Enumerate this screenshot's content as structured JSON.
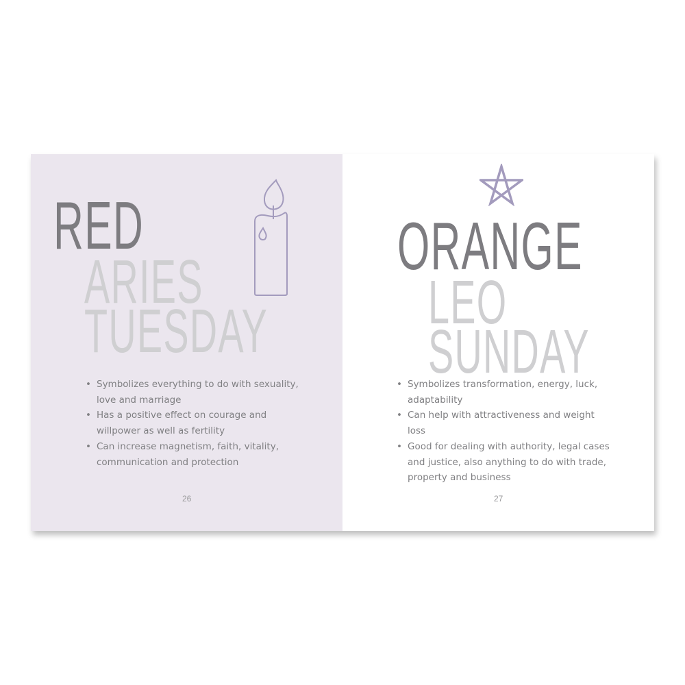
{
  "left_page": {
    "title": "RED",
    "zodiac": "ARIES",
    "day": "TUESDAY",
    "icon": "candle-icon",
    "bullets": [
      "Symbolizes everything to do with sexuality, love and marriage",
      "Has a positive effect on courage and willpower as well as fertility",
      "Can increase magnetism, faith, vitality, communication and protection"
    ],
    "page_number": "26"
  },
  "right_page": {
    "title": "ORANGE",
    "zodiac": "LEO",
    "day": "SUNDAY",
    "icon": "pentagram-icon",
    "bullets": [
      "Symbolizes transformation, energy, luck, adaptability",
      "Can help with attractiveness and weight loss",
      "Good for dealing with authority, legal cases and justice, also anything to do with trade, property and business"
    ],
    "page_number": "27"
  },
  "colors": {
    "left_background": "#ebe6ee",
    "accent": "#a39bbd",
    "title": "#7d7c80",
    "subtitle": "#cfcfd1"
  }
}
